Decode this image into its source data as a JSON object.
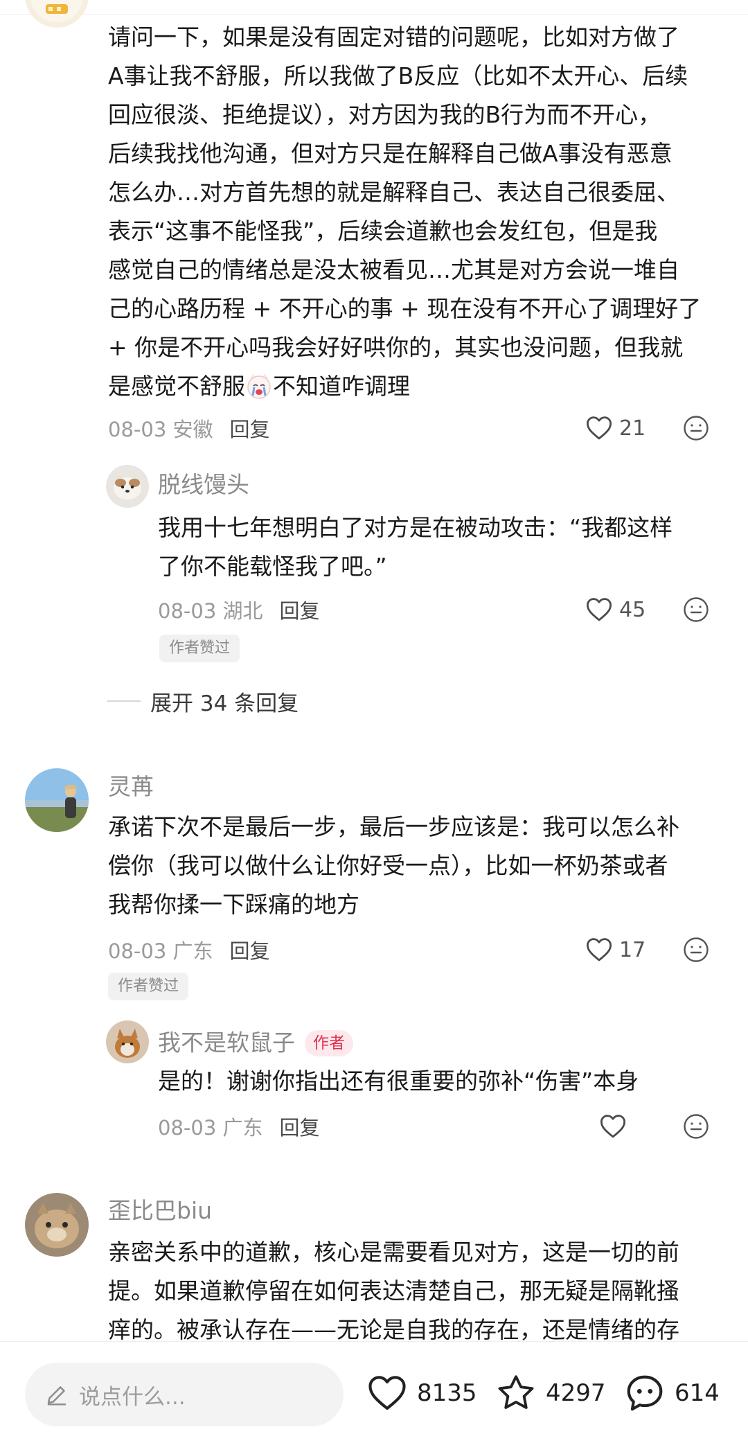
{
  "comments": {
    "c1": {
      "lines": [
        "请问一下，如果是没有固定对错的问题呢，比如对方做了",
        "A事让我不舒服，所以我做了B反应（比如不太开心、后续",
        "回应很淡、拒绝提议），对方因为我的B行为而不开心，",
        "后续我找他沟通，但对方只是在解释自己做A事没有恶意",
        "怎么办…对方首先想的就是解释自己、表达自己很委屈、",
        "表示“这事不能怪我”，后续会道歉也会发红包，但是我",
        "感觉自己的情绪总是没太被看见…尤其是对方会说一堆自",
        "己的心路历程 + 不开心的事 + 现在没有不开心了调理好了",
        "+ 你是不开心吗我会好好哄你的，其实也没问题，但我就",
        "是感觉不舒服"
      ],
      "line10_tail": "不知道咋调理",
      "date": "08-03 安徽",
      "reply": "回复",
      "likes": "21"
    },
    "r1": {
      "username": "脱线馒头",
      "lines": [
        "我用十七年想明白了对方是在被动攻击：“我都这样",
        "了你不能载怪我了吧。”"
      ],
      "date": "08-03 湖北",
      "reply": "回复",
      "likes": "45",
      "liked_tag": "作者赞过"
    },
    "expand_label": "展开 34 条回复",
    "c2": {
      "username": "灵苒",
      "lines": [
        "承诺下次不是最后一步，最后一步应该是：我可以怎么补",
        "偿你（我可以做什么让你好受一点），比如一杯奶茶或者",
        "我帮你揉一下踩痛的地方"
      ],
      "date": "08-03 广东",
      "reply": "回复",
      "likes": "17",
      "liked_tag": "作者赞过"
    },
    "r2": {
      "username": "我不是软鼠子",
      "author_tag": "作者",
      "lines": [
        "是的！谢谢你指出还有很重要的弥补“伤害”本身"
      ],
      "date": "08-03 广东",
      "reply": "回复"
    },
    "c3": {
      "username": "歪比巴biu",
      "lines": [
        "亲密关系中的道歉，核心是需要看见对方，这是一切的前",
        "提。如果道歉停留在如何表达清楚自己，那无疑是隔靴搔",
        "痒的。被承认存在——无论是自我的存在，还是情绪的存"
      ]
    }
  },
  "bottombar": {
    "placeholder": "说点什么...",
    "likes": "8135",
    "favorites": "4297",
    "comments": "614"
  },
  "colors": {
    "author_tag_bg": "#fde9ec",
    "author_tag_text": "#e0304e",
    "meta_gray": "#9a9a9a"
  },
  "icons": [
    "heart-icon",
    "emoji-icon",
    "star-icon",
    "comment-icon",
    "pen-icon",
    "crying-cat-emoji"
  ]
}
